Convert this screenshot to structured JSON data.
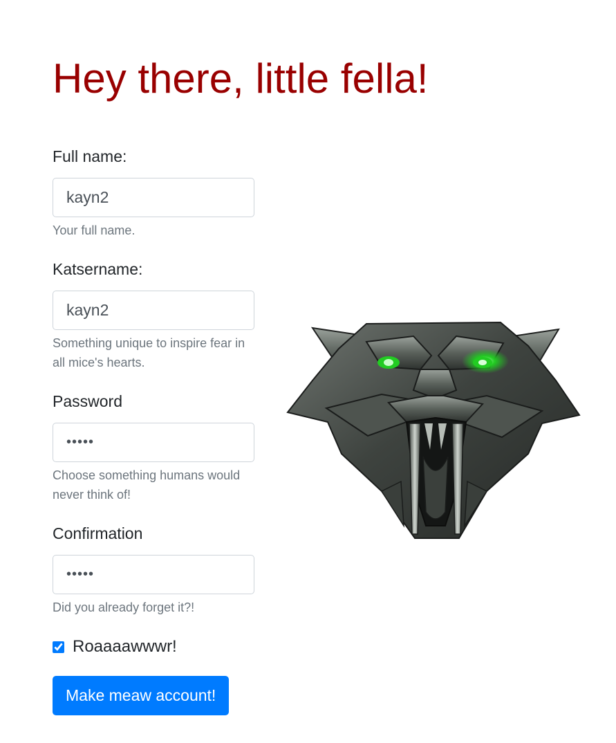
{
  "heading": "Hey there, little fella!",
  "form": {
    "full_name": {
      "label": "Full name:",
      "value": "kayn2",
      "help": "Your full name."
    },
    "katsername": {
      "label": "Katsername:",
      "value": "kayn2",
      "help": "Something unique to inspire fear in all mice's hearts."
    },
    "password": {
      "label": "Password",
      "value": "kayn2",
      "help": "Choose something humans would never think of!"
    },
    "confirmation": {
      "label": "Confirmation",
      "value": "kayn2",
      "help": "Did you already forget it?!"
    },
    "checkbox": {
      "label": "Roaaaawwwr!",
      "checked": true
    },
    "submit_label": "Make meaw account!"
  },
  "image": {
    "icon": "metal-cat-head-emblem",
    "eye_color": "#22cc22"
  },
  "colors": {
    "heading": "#990000",
    "button": "#007bff",
    "help_text": "#6c757d"
  }
}
